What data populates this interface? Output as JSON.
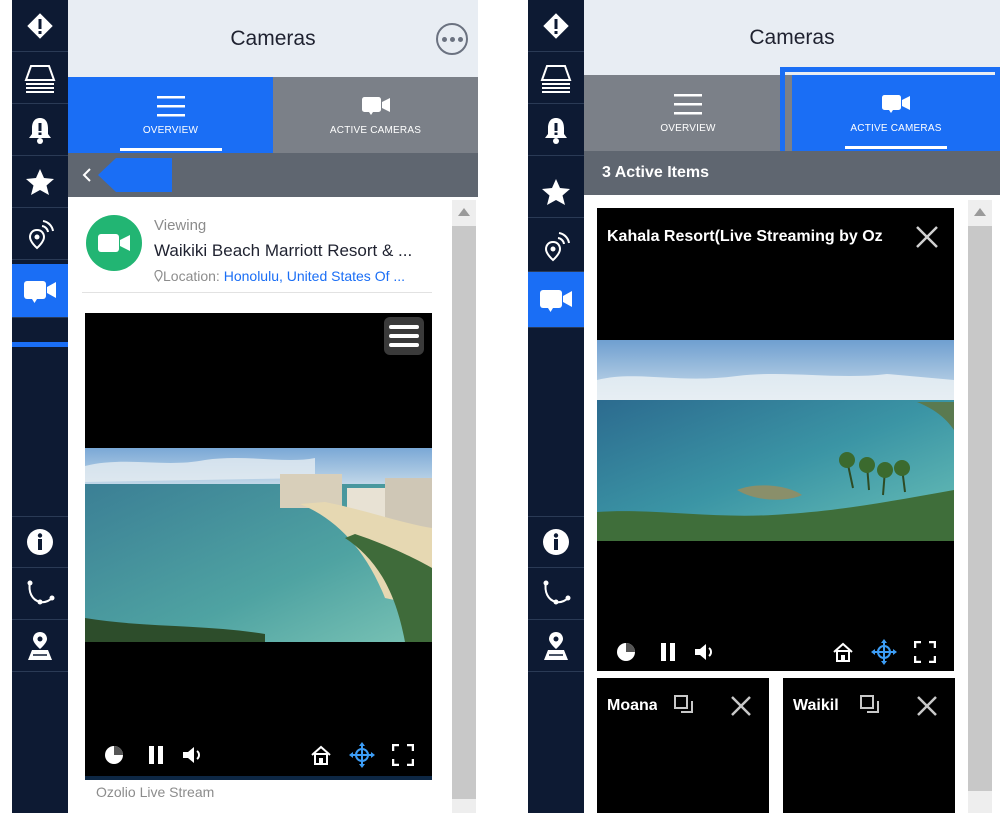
{
  "left": {
    "header": {
      "title": "Cameras"
    },
    "tabs": [
      {
        "label": "OVERVIEW"
      },
      {
        "label": "ACTIVE CAMERAS"
      }
    ],
    "camera": {
      "status": "Viewing",
      "name": "Waikiki Beach Marriott Resort & ...",
      "location_label": "Location: ",
      "location_value": "Honolulu, United States Of ..."
    },
    "video_caption": "Ozolio Live Stream"
  },
  "right": {
    "header": {
      "title": "Cameras"
    },
    "tabs": [
      {
        "label": "OVERVIEW"
      },
      {
        "label": "ACTIVE CAMERAS"
      }
    ],
    "active_count_text": "3 Active Items",
    "main_video": {
      "title": "Kahala Resort(Live Streaming by Oz"
    },
    "mini_videos": [
      {
        "title": "Moana"
      },
      {
        "title": "Waikil"
      }
    ]
  },
  "rail_icons": [
    "alert-diamond-icon",
    "layers-icon",
    "bell-alert-icon",
    "star-icon",
    "signal-pin-icon",
    "video-camera-icon",
    "info-icon",
    "route-icon",
    "map-pin-icon"
  ],
  "colors": {
    "accent": "#1a6ef5",
    "rail": "#0d1a33",
    "camera_green": "#22b573"
  }
}
